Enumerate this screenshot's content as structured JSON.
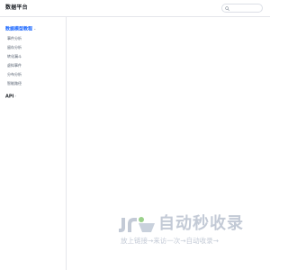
{
  "header": {
    "brand": "数据平台",
    "search_placeholder": ""
  },
  "sidebar": {
    "group_main": {
      "label": "数据模型教程",
      "expanded": true,
      "items": [
        {
          "label": "事件分析"
        },
        {
          "label": "留存分析"
        },
        {
          "label": "转化漏斗"
        },
        {
          "label": "虚拟事件"
        },
        {
          "label": "分布分析"
        },
        {
          "label": "智能路径"
        }
      ]
    },
    "group_api": {
      "label": "API",
      "expanded": false
    }
  },
  "watermark": {
    "title": "自动秒收录",
    "subtitle": "放上链接→来访一次→自动收录→"
  },
  "colors": {
    "accent": "#1664ff",
    "watermark": "#c3cad6"
  }
}
